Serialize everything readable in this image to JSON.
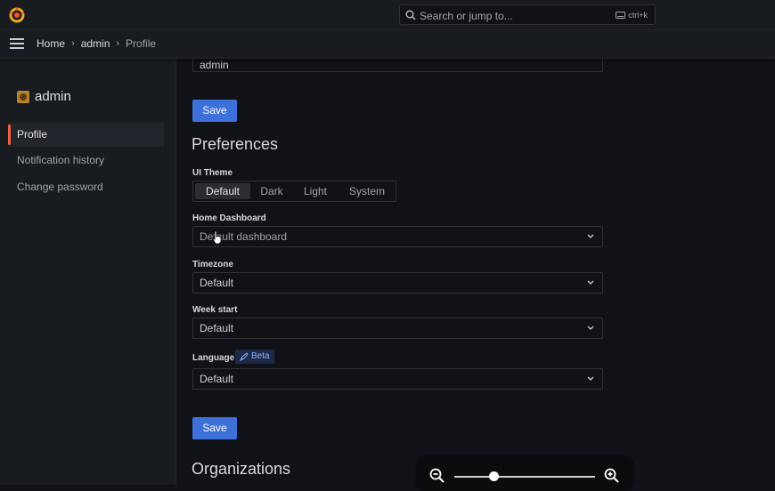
{
  "topbar": {
    "search_placeholder": "Search or jump to...",
    "shortcut": "ctrl+k"
  },
  "breadcrumb": [
    "Home",
    "admin",
    "Profile"
  ],
  "sidebar": {
    "title": "admin",
    "items": [
      {
        "label": "Profile",
        "active": true
      },
      {
        "label": "Notification history",
        "active": false
      },
      {
        "label": "Change password",
        "active": false
      }
    ]
  },
  "profile": {
    "name_value": "admin",
    "save_label": "Save"
  },
  "preferences": {
    "heading": "Preferences",
    "ui_theme_label": "UI Theme",
    "theme_options": [
      "Default",
      "Dark",
      "Light",
      "System"
    ],
    "theme_selected": "Default",
    "home_dashboard_label": "Home Dashboard",
    "home_dashboard_placeholder": "Default dashboard",
    "timezone_label": "Timezone",
    "timezone_value": "Default",
    "week_start_label": "Week start",
    "week_start_value": "Default",
    "language_label": "Language",
    "language_badge": "Beta",
    "language_value": "Default",
    "save_label": "Save"
  },
  "organizations": {
    "heading": "Organizations"
  },
  "colors": {
    "accent": "#3d71d9",
    "active_indicator": "#f55f3e",
    "background": "#111217",
    "panel": "#181b1f"
  }
}
